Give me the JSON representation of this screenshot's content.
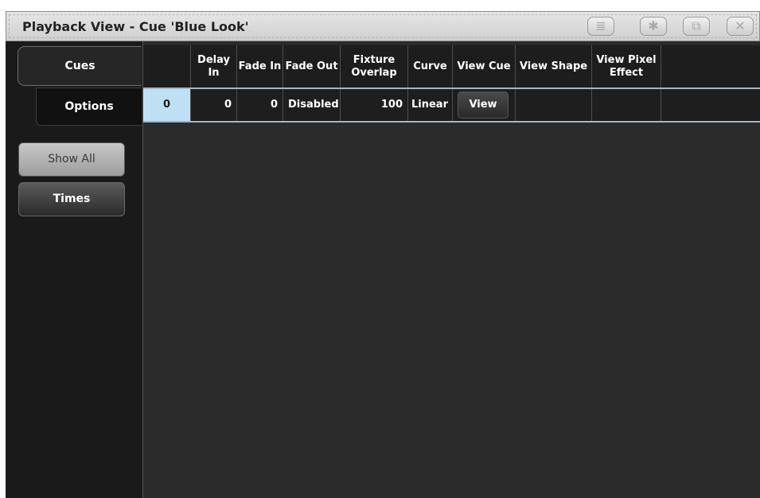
{
  "window": {
    "title": "Playback View - Cue 'Blue Look'",
    "title_buttons": [
      {
        "icon": "menu-icon",
        "glyph": "≣"
      },
      {
        "icon": "gear-icon",
        "glyph": "✱"
      },
      {
        "icon": "expand-icon",
        "glyph": "⧉"
      },
      {
        "icon": "close-icon",
        "glyph": "✕"
      }
    ]
  },
  "sidebar": {
    "tabs": [
      {
        "label": "Cues",
        "active": true
      },
      {
        "label": "Options",
        "active": false
      }
    ],
    "buttons": [
      {
        "label": "Show All"
      },
      {
        "label": "Times"
      }
    ]
  },
  "table": {
    "headers": [
      "",
      "Delay In",
      "Fade In",
      "Fade Out",
      "Fixture Overlap",
      "Curve",
      "View Cue",
      "View Shape",
      "View Pixel Effect",
      ""
    ],
    "row": {
      "cue": "0",
      "delay_in": "0",
      "fade_in": "0",
      "fade_out": "Disabled",
      "fixture_overlap": "100",
      "curve": "Linear",
      "view_cue": "View",
      "view_shape": "",
      "view_pixel_effect": ""
    }
  },
  "colors": {
    "background": "#2b2b2b",
    "selected_cell": "#bfe0f4",
    "row_border": "#9fb6c8",
    "titlebar": "#d9d9d9"
  }
}
